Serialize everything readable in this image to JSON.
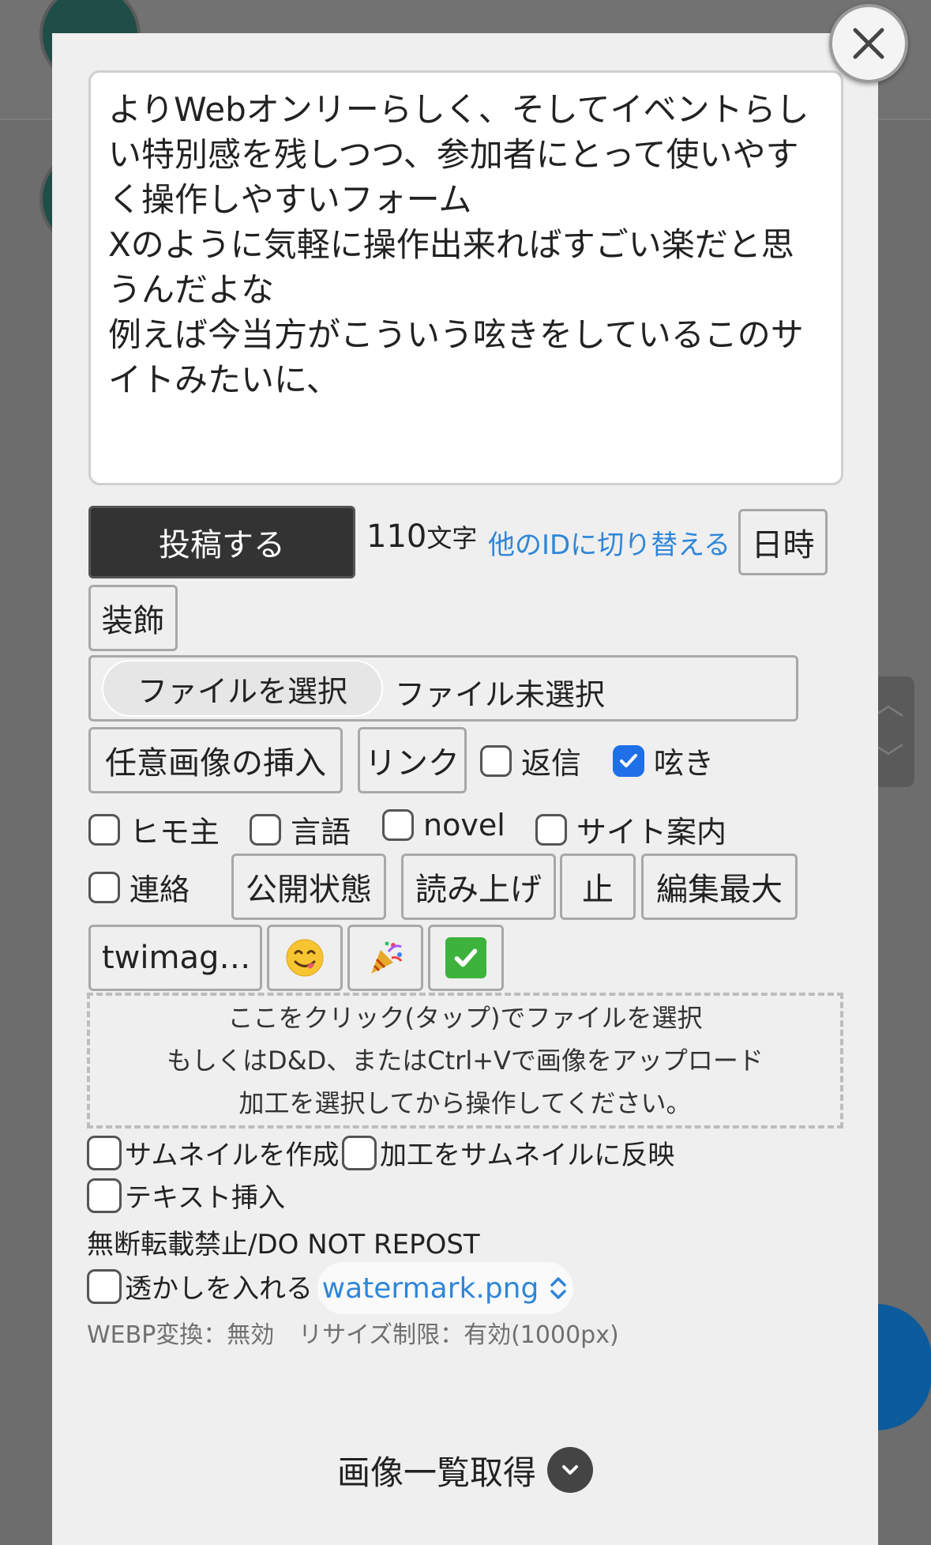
{
  "post_form": {
    "body_text": "よりWebオンリーらしく、そしてイベントらしい特別感を残しつつ、参加者にとって使いやすく操作しやすいフォーム\nXのように気軽に操作出来ればすごい楽だと思うんだよな\n例えば今当方がこういう呟きをしているこのサイトみたいに、",
    "submit_label": "投稿する",
    "char_count": "110",
    "char_unit": "文字",
    "switch_id_label": "他のIDに切り替える",
    "datetime_label": "日時",
    "decoration_label": "装飾",
    "file_choose_label": "ファイルを選択",
    "file_status": "ファイル未選択",
    "insert_image_label": "任意画像の挿入",
    "link_label": "リンク",
    "checkboxes": {
      "reply": {
        "label": "返信",
        "checked": false
      },
      "tweet": {
        "label": "呟き",
        "checked": true
      },
      "himo": {
        "label": "ヒモ主",
        "checked": false
      },
      "language": {
        "label": "言語",
        "checked": false
      },
      "novel": {
        "label": "novel",
        "checked": false
      },
      "site_guide": {
        "label": "サイト案内",
        "checked": false
      },
      "contact": {
        "label": "連絡",
        "checked": false
      }
    },
    "visibility_label": "公開状態",
    "read_aloud_label": "読み上げ",
    "stop_label": "止",
    "edit_max_label": "編集最大",
    "twimage_label": "twimag…",
    "emoji_buttons": [
      "smiling-face-savoring-food",
      "party-popper",
      "white-heavy-check-mark"
    ]
  },
  "upload": {
    "dropzone_lines": [
      "ここをクリック(タップ)でファイルを選択",
      "もしくはD&D、またはCtrl+Vで画像をアップロード",
      "加工を選択してから操作してください。"
    ],
    "create_thumbnail": {
      "label": "サムネイルを作成",
      "checked": false
    },
    "apply_to_thumbnail": {
      "label": "加工をサムネイルに反映",
      "checked": false
    },
    "insert_text": {
      "label": "テキスト挿入",
      "checked": false
    },
    "repost_notice": "無断転載禁止/DO NOT REPOST",
    "watermark": {
      "label": "透かしを入れる",
      "checked": false
    },
    "watermark_file": "watermark.png",
    "webp_note": "WEBP変換：無効",
    "resize_note": "リサイズ制限：有効(1000px)"
  },
  "fetch_images_label": "画像一覧取得",
  "colors": {
    "accent_blue": "#2f86d8",
    "checkbox_blue": "#1f6fe8",
    "submit_bg": "#333333",
    "modal_bg": "#efefef"
  }
}
